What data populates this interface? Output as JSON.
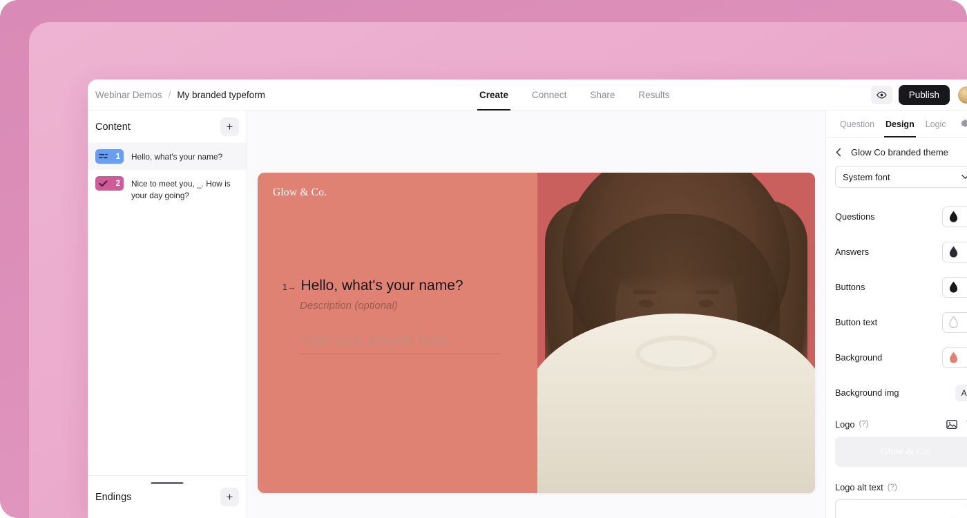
{
  "window": {
    "breadcrumb": {
      "workspace": "Webinar Demos",
      "separator": "/",
      "form_name": "My branded typeform"
    },
    "nav_tabs": [
      {
        "label": "Create",
        "active": true
      },
      {
        "label": "Connect",
        "active": false
      },
      {
        "label": "Share",
        "active": false
      },
      {
        "label": "Results",
        "active": false
      }
    ],
    "preview_icon": "eye-icon",
    "publish_label": "Publish",
    "avatar": "user-avatar"
  },
  "sidebar": {
    "title": "Content",
    "add_label": "+",
    "questions": [
      {
        "number": "1",
        "type_icon": "short-text-icon",
        "badge_color": "#6c9ef0",
        "text": "Hello, what's your name?",
        "selected": true
      },
      {
        "number": "2",
        "type_icon": "check-icon",
        "badge_color": "#cd5d99",
        "text": "Nice to meet you, _. How is your day going?",
        "selected": false
      }
    ],
    "endings_title": "Endings",
    "endings_add_label": "+"
  },
  "preview": {
    "logo_text": "Glow & Co.",
    "question_number": "1",
    "question_arrow": "→",
    "question_title": "Hello, what's your name?",
    "description_placeholder": "Description (optional)",
    "answer_placeholder": "Type your answer here...",
    "background_color": "#e08273"
  },
  "design_panel": {
    "tabs": [
      {
        "label": "Question",
        "active": false
      },
      {
        "label": "Design",
        "active": true
      },
      {
        "label": "Logic",
        "active": false
      }
    ],
    "settings_icon": "gear-icon",
    "back_icon": "chevron-left-icon",
    "theme_name": "Glow Co branded theme",
    "font_select": {
      "value": "System font",
      "chevron": "chevron-down-icon"
    },
    "color_rows": [
      {
        "label": "Questions",
        "swatch": "#17171c",
        "icon": "droplet-icon"
      },
      {
        "label": "Answers",
        "swatch": "#2a2a30",
        "icon": "droplet-icon"
      },
      {
        "label": "Buttons",
        "swatch": "#17171c",
        "icon": "droplet-icon"
      },
      {
        "label": "Button text",
        "swatch": "#ffffff",
        "icon": "droplet-outline-icon"
      },
      {
        "label": "Background",
        "swatch": "#e08273",
        "icon": "droplet-icon"
      }
    ],
    "background_img": {
      "label": "Background img",
      "button_label": "Add"
    },
    "logo": {
      "label": "Logo",
      "help": "(?)",
      "image_icon": "image-icon",
      "delete_icon": "trash-icon",
      "preview_text": "Glow & Co."
    },
    "logo_alt": {
      "label": "Logo alt text",
      "help": "(?)"
    }
  }
}
